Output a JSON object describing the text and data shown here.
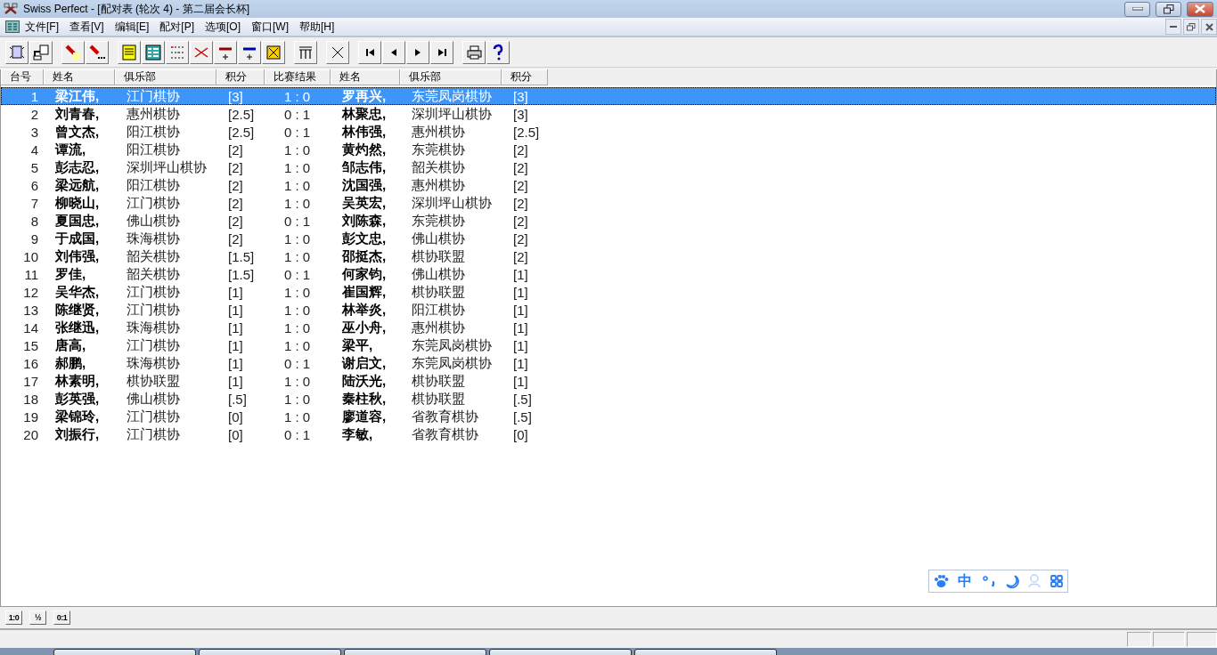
{
  "window": {
    "title": "Swiss Perfect - [配对表 (轮次 4) - 第二届会长杯]"
  },
  "menu": [
    "文件[F]",
    "查看[V]",
    "编辑[E]",
    "配对[P]",
    "选项[O]",
    "窗口[W]",
    "帮助[H]"
  ],
  "table": {
    "columns": [
      "台号",
      "姓名",
      "俱乐部",
      "积分",
      "比赛结果",
      "姓名",
      "俱乐部",
      "积分"
    ],
    "rows": [
      {
        "board": "1",
        "white": "梁江伟,",
        "white_club": "江门棋协",
        "white_score": "[3]",
        "result": "1 : 0",
        "black": "罗再兴,",
        "black_club": "东莞凤岗棋协",
        "black_score": "[3]",
        "selected": true
      },
      {
        "board": "2",
        "white": "刘青春,",
        "white_club": "惠州棋协",
        "white_score": "[2.5]",
        "result": "0 : 1",
        "black": "林聚忠,",
        "black_club": "深圳坪山棋协",
        "black_score": "[3]",
        "selected": false
      },
      {
        "board": "3",
        "white": "曾文杰,",
        "white_club": "阳江棋协",
        "white_score": "[2.5]",
        "result": "0 : 1",
        "black": "林伟强,",
        "black_club": "惠州棋协",
        "black_score": "[2.5]",
        "selected": false
      },
      {
        "board": "4",
        "white": "谭流,",
        "white_club": "阳江棋协",
        "white_score": "[2]",
        "result": "1 : 0",
        "black": "黄灼然,",
        "black_club": "东莞棋协",
        "black_score": "[2]",
        "selected": false
      },
      {
        "board": "5",
        "white": "彭志忍,",
        "white_club": "深圳坪山棋协",
        "white_score": "[2]",
        "result": "1 : 0",
        "black": "邹志伟,",
        "black_club": "韶关棋协",
        "black_score": "[2]",
        "selected": false
      },
      {
        "board": "6",
        "white": "梁远航,",
        "white_club": "阳江棋协",
        "white_score": "[2]",
        "result": "1 : 0",
        "black": "沈国强,",
        "black_club": "惠州棋协",
        "black_score": "[2]",
        "selected": false
      },
      {
        "board": "7",
        "white": "柳晓山,",
        "white_club": "江门棋协",
        "white_score": "[2]",
        "result": "1 : 0",
        "black": "吴英宏,",
        "black_club": "深圳坪山棋协",
        "black_score": "[2]",
        "selected": false
      },
      {
        "board": "8",
        "white": "夏国忠,",
        "white_club": "佛山棋协",
        "white_score": "[2]",
        "result": "0 : 1",
        "black": "刘陈森,",
        "black_club": "东莞棋协",
        "black_score": "[2]",
        "selected": false
      },
      {
        "board": "9",
        "white": "于成国,",
        "white_club": "珠海棋协",
        "white_score": "[2]",
        "result": "1 : 0",
        "black": "彭文忠,",
        "black_club": "佛山棋协",
        "black_score": "[2]",
        "selected": false
      },
      {
        "board": "10",
        "white": "刘伟强,",
        "white_club": "韶关棋协",
        "white_score": "[1.5]",
        "result": "1 : 0",
        "black": "邵挺杰,",
        "black_club": "棋协联盟",
        "black_score": "[2]",
        "selected": false
      },
      {
        "board": "11",
        "white": "罗佳,",
        "white_club": "韶关棋协",
        "white_score": "[1.5]",
        "result": "0 : 1",
        "black": "何家钧,",
        "black_club": "佛山棋协",
        "black_score": "[1]",
        "selected": false
      },
      {
        "board": "12",
        "white": "吴华杰,",
        "white_club": "江门棋协",
        "white_score": "[1]",
        "result": "1 : 0",
        "black": "崔国辉,",
        "black_club": "棋协联盟",
        "black_score": "[1]",
        "selected": false
      },
      {
        "board": "13",
        "white": "陈继贤,",
        "white_club": "江门棋协",
        "white_score": "[1]",
        "result": "1 : 0",
        "black": "林举炎,",
        "black_club": "阳江棋协",
        "black_score": "[1]",
        "selected": false
      },
      {
        "board": "14",
        "white": "张继迅,",
        "white_club": "珠海棋协",
        "white_score": "[1]",
        "result": "1 : 0",
        "black": "巫小舟,",
        "black_club": "惠州棋协",
        "black_score": "[1]",
        "selected": false
      },
      {
        "board": "15",
        "white": "唐高,",
        "white_club": "江门棋协",
        "white_score": "[1]",
        "result": "1 : 0",
        "black": "梁平,",
        "black_club": "东莞凤岗棋协",
        "black_score": "[1]",
        "selected": false
      },
      {
        "board": "16",
        "white": "郝鹏,",
        "white_club": "珠海棋协",
        "white_score": "[1]",
        "result": "0 : 1",
        "black": "谢启文,",
        "black_club": "东莞凤岗棋协",
        "black_score": "[1]",
        "selected": false
      },
      {
        "board": "17",
        "white": "林素明,",
        "white_club": "棋协联盟",
        "white_score": "[1]",
        "result": "1 : 0",
        "black": "陆沃光,",
        "black_club": "棋协联盟",
        "black_score": "[1]",
        "selected": false
      },
      {
        "board": "18",
        "white": "彭英强,",
        "white_club": "佛山棋协",
        "white_score": "[.5]",
        "result": "1 : 0",
        "black": "秦柱秋,",
        "black_club": "棋协联盟",
        "black_score": "[.5]",
        "selected": false
      },
      {
        "board": "19",
        "white": "梁锦玲,",
        "white_club": "江门棋协",
        "white_score": "[0]",
        "result": "1 : 0",
        "black": "廖道容,",
        "black_club": "省教育棋协",
        "black_score": "[.5]",
        "selected": false
      },
      {
        "board": "20",
        "white": "刘振行,",
        "white_club": "江门棋协",
        "white_score": "[0]",
        "result": "0 : 1",
        "black": "李敏,",
        "black_club": "省教育棋协",
        "black_score": "[0]",
        "selected": false
      }
    ]
  },
  "result_buttons": [
    "1:0",
    "½",
    "0:1"
  ],
  "ime_bar": {
    "mode": "中"
  }
}
